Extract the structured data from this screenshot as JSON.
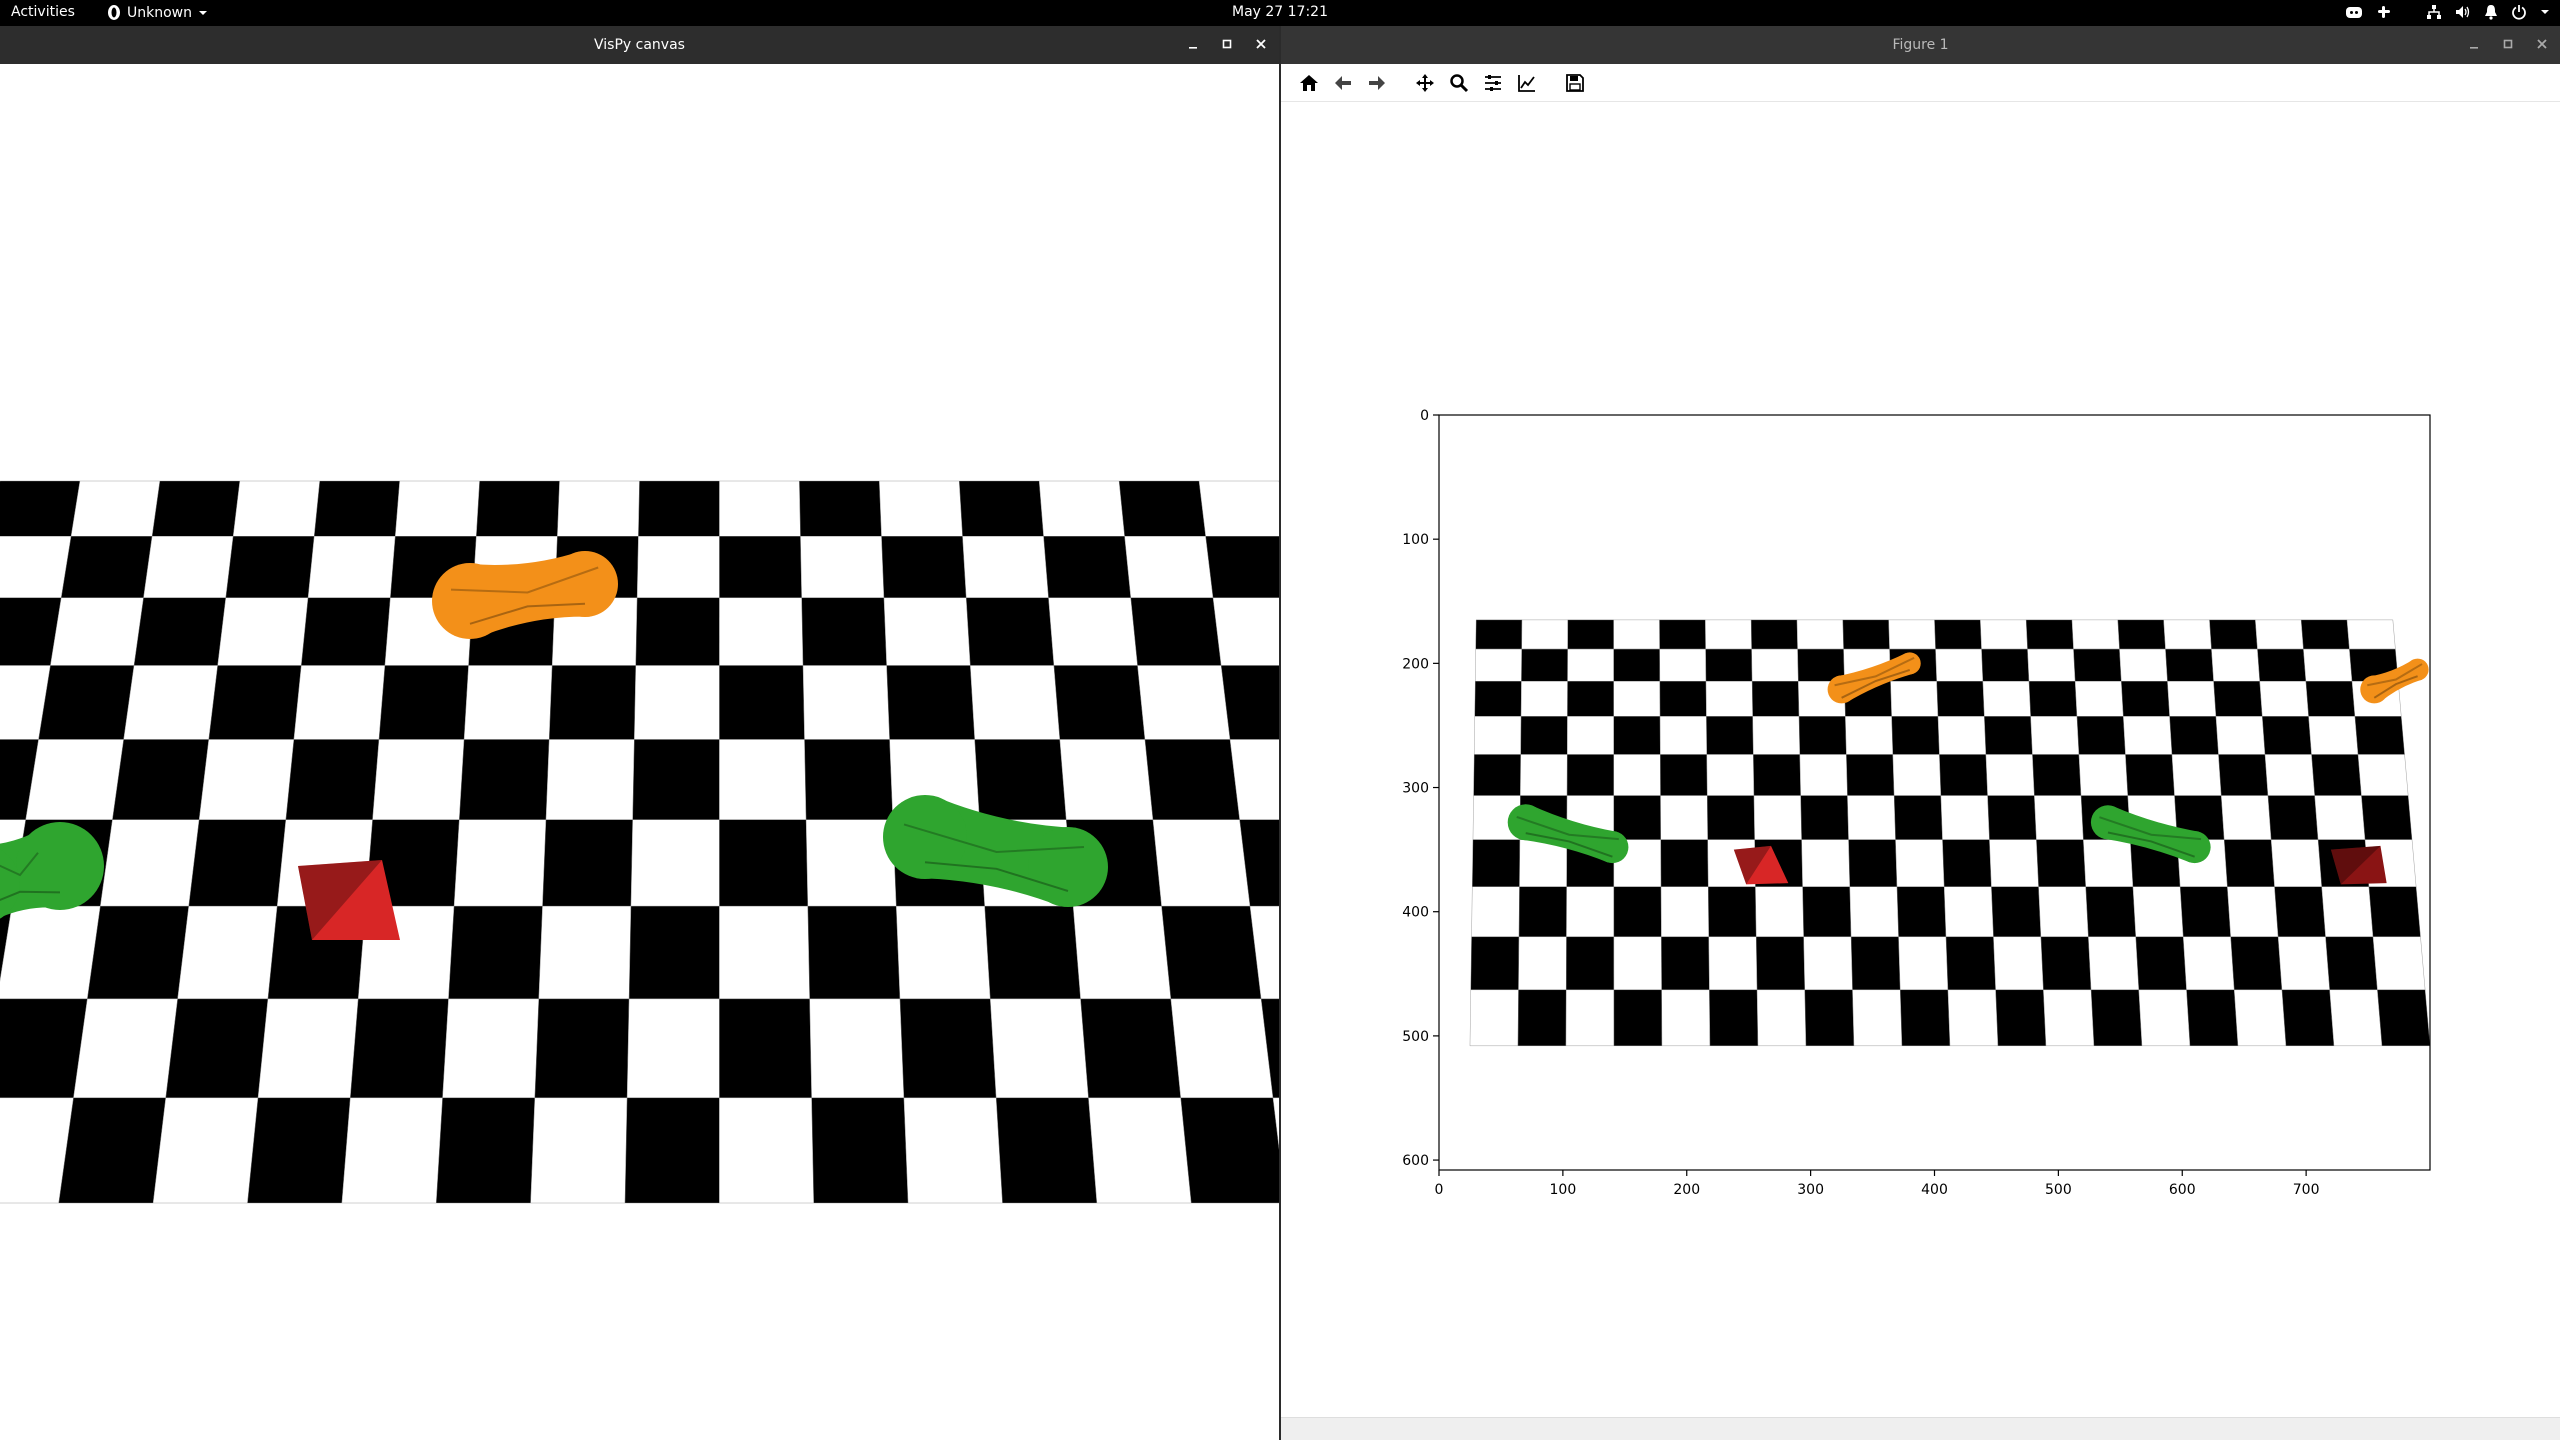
{
  "topbar": {
    "activities": "Activities",
    "app_name": "Unknown",
    "clock": "May 27  17:21",
    "tray_icons": [
      "discord-icon",
      "slack-icon",
      "network-icon",
      "volume-icon",
      "notification-icon",
      "power-icon",
      "chevron-down-icon"
    ]
  },
  "windows": {
    "vispy": {
      "title": "VisPy canvas"
    },
    "figure": {
      "title": "Figure 1"
    }
  },
  "toolbar": {
    "items": [
      "home-icon",
      "back-icon",
      "forward-icon",
      "pan-icon",
      "zoom-icon",
      "configure-subplots-icon",
      "edit-axis-icon",
      "save-icon"
    ]
  },
  "figure_axes": {
    "x_ticks": [
      "0",
      "100",
      "200",
      "300",
      "400",
      "500",
      "600",
      "700"
    ],
    "y_ticks": [
      "0",
      "100",
      "200",
      "300",
      "400",
      "500",
      "600"
    ],
    "xlim": [
      0,
      800
    ],
    "ylim": [
      608,
      0
    ]
  },
  "colors": {
    "checker_dark": "#000000",
    "checker_light": "#ffffff",
    "green_object": "#2fa52f",
    "orange_object": "#f39019",
    "red_object": "#d82626",
    "titlebar": "#2d2d2d",
    "topbar": "#000000"
  }
}
